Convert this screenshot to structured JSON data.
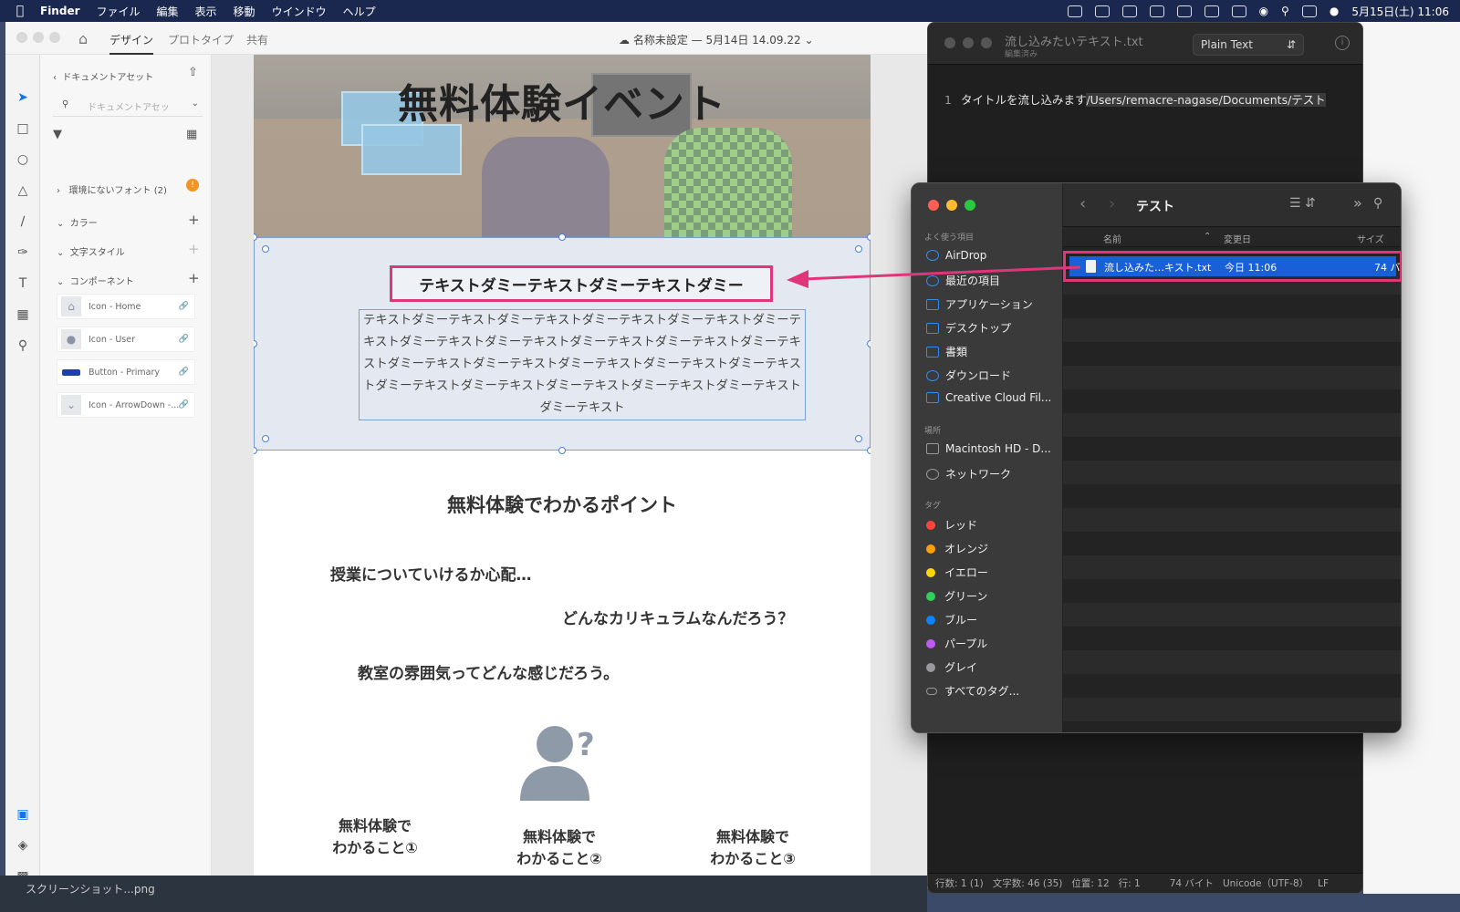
{
  "menubar": {
    "app": "Finder",
    "items": [
      "ファイル",
      "編集",
      "表示",
      "移動",
      "ウインドウ",
      "ヘルプ"
    ],
    "clock": "5月15日(土) 11:06"
  },
  "xd": {
    "tabs": [
      "デザイン",
      "プロトタイプ",
      "共有"
    ],
    "doc_title": "名称未設定 — 5月14日 14.09.22",
    "panel": {
      "back_label": "ドキュメントアセット",
      "search_placeholder": "ドキュメントアセッ",
      "missing_fonts": "環境にないフォント (2)",
      "colors": "カラー",
      "char_styles": "文字スタイル",
      "components": "コンポーネント",
      "component_items": [
        "Icon - Home",
        "Icon - User",
        "Button - Primary",
        "Icon - ArrowDown -..."
      ]
    },
    "artboard": {
      "hero_title": "無料体験イベント",
      "heading": "テキストダミーテキストダミーテキストダミー",
      "body": "テキストダミーテキストダミーテキストダミーテキストダミーテキストダミーテキストダミーテキストダミーテキストダミーテキストダミーテキストダミーテキストダミーテキストダミーテキストダミーテキストダミーテキストダミーテキストダミーテキストダミーテキストダミーテキストダミーテキストダミーテキストダミーテキスト",
      "section_title": "無料体験でわかるポイント",
      "q1": "授業についていけるか心配…",
      "q2": "どんなカリキュラムなんだろう？",
      "q3": "教室の雰囲気ってどんな感じだろう。",
      "cap1": "無料体験で\nわかること①",
      "cap2": "無料体験で\nわかること②",
      "cap3": "無料体験で\nわかること③"
    }
  },
  "texteditor": {
    "filename": "流し込みたいテキスト.txt",
    "subtitle": "編集済み",
    "format": "Plain Text",
    "line_no": "1",
    "line_text": "タイトルを流し込みます",
    "line_path": "/Users/remacre-nagase/Documents/テスト",
    "status": {
      "rows": "行数: 1 (1)",
      "chars": "文字数: 46 (35)",
      "pos": "位置: 12",
      "line": "行: 1",
      "bytes": "74 バイト",
      "encoding": "Unicode（UTF-8）",
      "eol": "LF"
    }
  },
  "finder": {
    "folder": "テスト",
    "favorites_head": "よく使う項目",
    "favorites": [
      "AirDrop",
      "最近の項目",
      "アプリケーション",
      "デスクトップ",
      "書類",
      "ダウンロード",
      "Creative Cloud Fil..."
    ],
    "places_head": "場所",
    "places": [
      "Macintosh HD - D...",
      "ネットワーク"
    ],
    "tags_head": "タグ",
    "tags": [
      {
        "name": "レッド",
        "color": "#ff453a"
      },
      {
        "name": "オレンジ",
        "color": "#ff9f0a"
      },
      {
        "name": "イエロー",
        "color": "#ffd60a"
      },
      {
        "name": "グリーン",
        "color": "#30d158"
      },
      {
        "name": "ブルー",
        "color": "#0a84ff"
      },
      {
        "name": "パープル",
        "color": "#bf5af2"
      },
      {
        "name": "グレイ",
        "color": "#98989d"
      }
    ],
    "all_tags": "すべてのタグ...",
    "columns": {
      "name": "名前",
      "date": "変更日",
      "size": "サイズ"
    },
    "file": {
      "name": "流し込みた…キスト.txt",
      "date": "今日 11:06",
      "size": "74 バ"
    }
  },
  "dock": {
    "label": "スクリーンショット...png"
  },
  "accent": "#e0357a"
}
